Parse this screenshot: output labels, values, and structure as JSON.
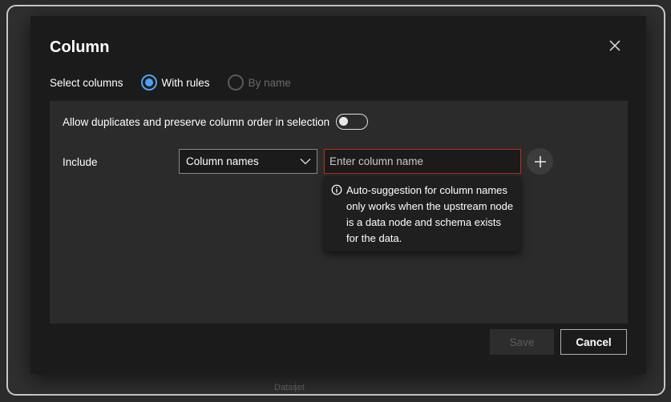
{
  "dialog": {
    "title": "Column",
    "close_label": "×"
  },
  "select_columns": {
    "label": "Select columns",
    "options": [
      {
        "label": "With rules",
        "selected": true
      },
      {
        "label": "By name",
        "selected": false
      }
    ]
  },
  "rules_panel": {
    "duplicates_label": "Allow duplicates and preserve column order in selection",
    "duplicates_enabled": false,
    "include_label": "Include",
    "match_type": "Column names",
    "column_input_value": "",
    "column_input_placeholder": "Enter column name",
    "tooltip_text": "Auto-suggestion for column names only works when the upstream node is a data node and schema exists for the data."
  },
  "footer": {
    "save_label": "Save",
    "cancel_label": "Cancel"
  },
  "background": {
    "node_label": "Dataset"
  },
  "colors": {
    "accent": "#4ea1f3",
    "error_border": "#c42b1c",
    "dialog_bg": "#1b1b1b",
    "panel_bg": "#2b2b2b"
  },
  "icons": {
    "close": "close-icon",
    "chevron": "chevron-down-icon",
    "add": "plus-icon",
    "info": "info-icon"
  }
}
